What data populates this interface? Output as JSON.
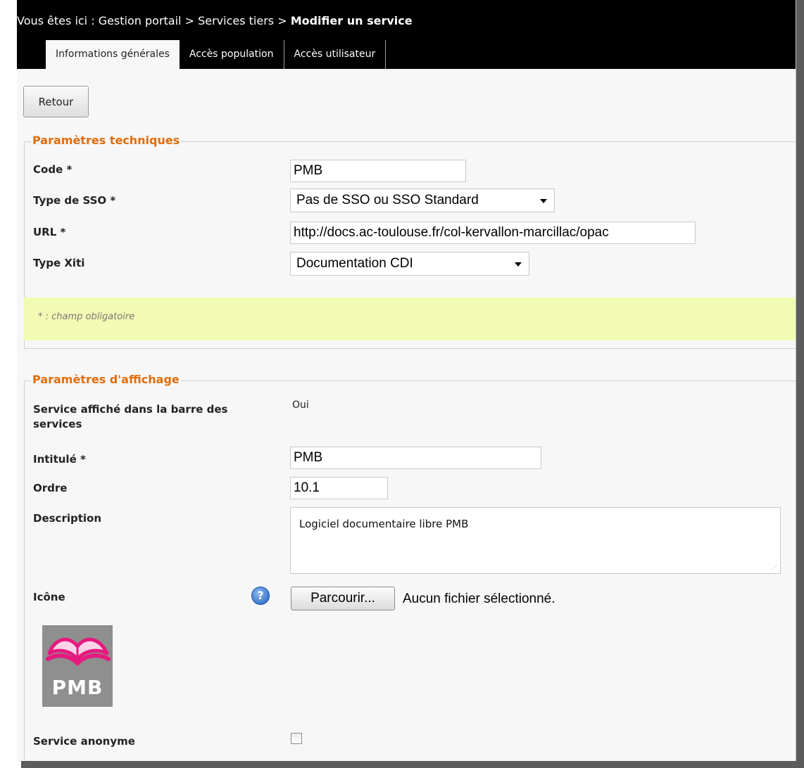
{
  "breadcrumb": {
    "prefix": "Vous êtes ici : Gestion portail > Services tiers > ",
    "current": "Modifier un service"
  },
  "tabs": [
    {
      "label": "Informations générales",
      "active": true
    },
    {
      "label": "Accès population",
      "active": false
    },
    {
      "label": "Accès utilisateur",
      "active": false
    }
  ],
  "back_button": "Retour",
  "technical": {
    "legend": "Paramètres techniques",
    "code_label": "Code *",
    "code_value": "PMB",
    "sso_label": "Type de SSO *",
    "sso_value": "Pas de SSO ou SSO Standard",
    "url_label": "URL *",
    "url_value": "http://docs.ac-toulouse.fr/col-kervallon-marcillac/opac",
    "xiti_label": "Type Xiti",
    "xiti_value": "Documentation CDI",
    "note": "* : champ obligatoire"
  },
  "display": {
    "legend": "Paramètres d'affichage",
    "shown_label_line1": "Service affiché dans la barre des",
    "shown_label_line2": "services",
    "shown_value": "Oui",
    "title_label": "Intitulé *",
    "title_value": "PMB",
    "order_label": "Ordre",
    "order_value": "10.1",
    "description_label": "Description",
    "description_value": "Logiciel documentaire libre PMB",
    "icon_label": "Icône",
    "help_glyph": "?",
    "browse_button": "Parcourir...",
    "no_file": "Aucun fichier sélectionné.",
    "icon_logo_text": "PMB",
    "anonymous_label": "Service anonyme"
  },
  "colors": {
    "legend": "#e36c0a",
    "note_background": "#f2fbb3",
    "top_bar": "#000000",
    "logo_pink": "#e6197f"
  },
  "icons": {
    "help": "question-mark-circle-icon",
    "logo": "open-book-pmb-logo"
  }
}
